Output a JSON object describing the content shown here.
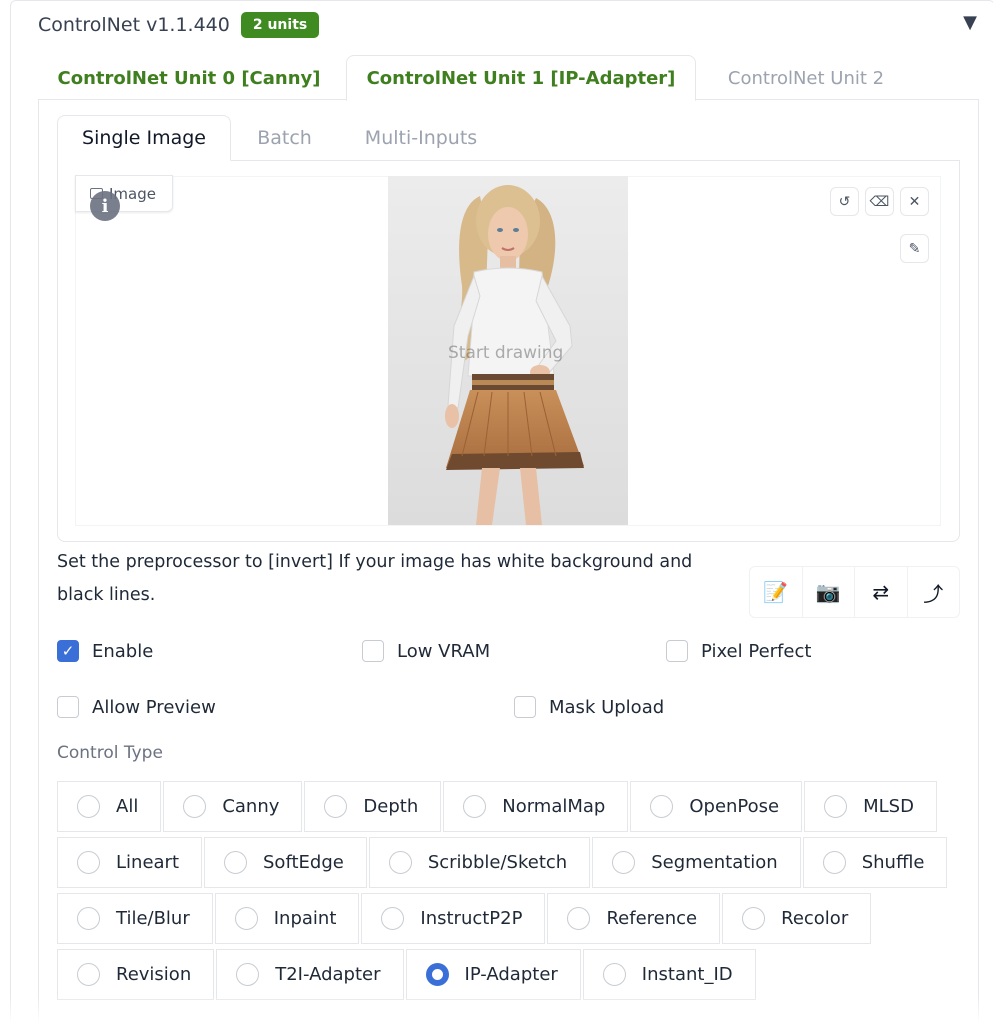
{
  "header": {
    "title": "ControlNet v1.1.440",
    "badge": "2 units",
    "collapse_icon": "triangle-down-icon"
  },
  "unit_tabs": [
    {
      "label": "ControlNet Unit 0 [Canny]"
    },
    {
      "label": "ControlNet Unit 1 [IP-Adapter]"
    },
    {
      "label": "ControlNet Unit 2"
    }
  ],
  "image_tabs": [
    {
      "label": "Single Image"
    },
    {
      "label": "Batch"
    },
    {
      "label": "Multi-Inputs"
    }
  ],
  "image_area": {
    "label": "Image",
    "info": "i",
    "overlay_text": "Start drawing"
  },
  "hint": "Set the preprocessor to [invert] If your image has white background and black lines.",
  "action_buttons": [
    "📝",
    "📷",
    "⇄",
    "⤴"
  ],
  "checkboxes": {
    "enable": {
      "label": "Enable",
      "checked": true
    },
    "low_vram": {
      "label": "Low VRAM",
      "checked": false
    },
    "pixel_perfect": {
      "label": "Pixel Perfect",
      "checked": false
    },
    "allow_preview": {
      "label": "Allow Preview",
      "checked": false
    },
    "mask_upload": {
      "label": "Mask Upload",
      "checked": false
    }
  },
  "control_type": {
    "label": "Control Type",
    "selected": "IP-Adapter",
    "rows": [
      [
        "All",
        "Canny",
        "Depth",
        "NormalMap",
        "OpenPose",
        "MLSD"
      ],
      [
        "Lineart",
        "SoftEdge",
        "Scribble/Sketch",
        "Segmentation",
        "Shuffle"
      ],
      [
        "Tile/Blur",
        "Inpaint",
        "InstructP2P",
        "Reference",
        "Recolor"
      ],
      [
        "Revision",
        "T2I-Adapter",
        "IP-Adapter",
        "Instant_ID"
      ]
    ]
  },
  "colors": {
    "accent_green": "#3f8b22",
    "accent_blue": "#3b6fd8"
  }
}
